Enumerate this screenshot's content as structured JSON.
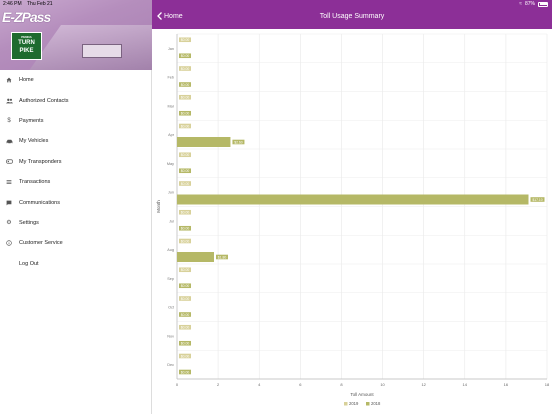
{
  "status": {
    "time": "2:46 PM",
    "date": "Thu Feb 21",
    "battery": "87%"
  },
  "brand": {
    "logo_text": "E-ZPass",
    "shield_top": "PENNA",
    "shield_line1": "TURN",
    "shield_line2": "PIKE"
  },
  "menu": [
    {
      "label": "Home",
      "icon": "home-icon"
    },
    {
      "label": "Authorized Contacts",
      "icon": "people-icon"
    },
    {
      "label": "Payments",
      "icon": "dollar-icon"
    },
    {
      "label": "My Vehicles",
      "icon": "car-icon"
    },
    {
      "label": "My Transponders",
      "icon": "transponder-icon"
    },
    {
      "label": "Transactions",
      "icon": "list-icon"
    },
    {
      "label": "Communications",
      "icon": "message-icon"
    },
    {
      "label": "Settings",
      "icon": "gear-icon"
    },
    {
      "label": "Customer Service",
      "icon": "info-icon"
    },
    {
      "label": "Log Out",
      "icon": ""
    }
  ],
  "navbar": {
    "back_label": "Home",
    "title": "Toll Usage Summary"
  },
  "colors": {
    "purple": "#8c2f97",
    "series_2019": "#d8d19a",
    "series_2018": "#b5b866"
  },
  "chart_data": {
    "type": "bar",
    "orientation": "horizontal",
    "categories": [
      "Jan",
      "Feb",
      "Mar",
      "Apr",
      "May",
      "Jun",
      "Jul",
      "Aug",
      "Sep",
      "Oct",
      "Nov",
      "Dec"
    ],
    "series": [
      {
        "name": "2019",
        "values": [
          0,
          0,
          0,
          0,
          0,
          0,
          0,
          0,
          0,
          0,
          0,
          0
        ],
        "labels": [
          "$0.00",
          "$0.00",
          "$0.00",
          "$0.00",
          "$0.00",
          "$0.00",
          "$0.00",
          "$0.00",
          "$0.00",
          "$0.00",
          "$0.00",
          "$0.00"
        ]
      },
      {
        "name": "2018",
        "values": [
          0,
          0,
          0,
          2.6,
          0,
          17.1,
          0,
          1.8,
          0,
          0,
          0,
          0
        ],
        "labels": [
          "$0.00",
          "$0.00",
          "$0.00",
          "$2.60",
          "$0.00",
          "$17.10",
          "$0.00",
          "$1.80",
          "$0.00",
          "$0.00",
          "$0.00",
          "$0.00"
        ]
      }
    ],
    "xlabel": "Toll Amount",
    "ylabel": "Month",
    "xlim": [
      0,
      18
    ],
    "xticks": [
      "0",
      "2",
      "4",
      "6",
      "8",
      "10",
      "12",
      "14",
      "16",
      "18"
    ],
    "grid": true,
    "legend_position": "bottom-center"
  }
}
